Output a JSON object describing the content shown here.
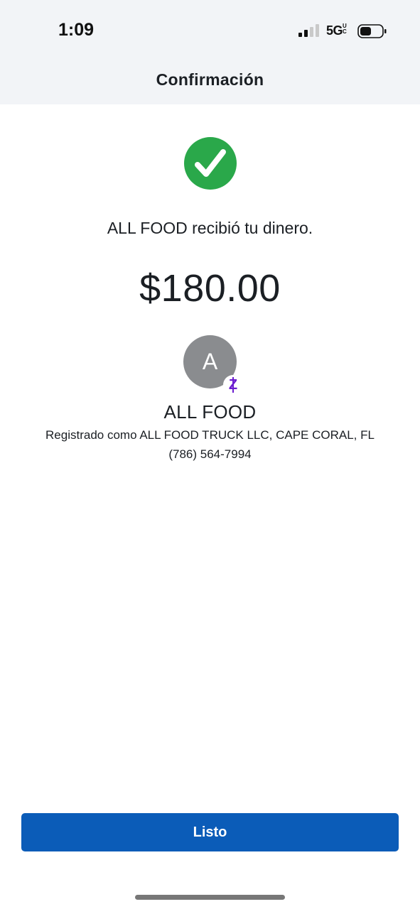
{
  "status_bar": {
    "time": "1:09",
    "network": "5G",
    "network_suffix": "UC",
    "signal_icon": "cellular-signal-icon",
    "battery_icon": "battery-icon"
  },
  "header": {
    "title": "Confirmación"
  },
  "confirmation": {
    "status_icon": "check-circle-icon",
    "message": "ALL FOOD recibió tu dinero.",
    "amount": "$180.00"
  },
  "recipient": {
    "avatar_initial": "A",
    "badge": "Z",
    "badge_icon": "zelle-icon",
    "name": "ALL FOOD",
    "registered_as": "Registrado como ALL FOOD TRUCK LLC, CAPE CORAL, FL",
    "phone": "(786) 564-7994"
  },
  "actions": {
    "done_label": "Listo"
  },
  "colors": {
    "success": "#2aa84a",
    "primary_button": "#0b5cb8",
    "zelle_purple": "#6b1ccf",
    "avatar_gray": "#8a8c8f"
  }
}
